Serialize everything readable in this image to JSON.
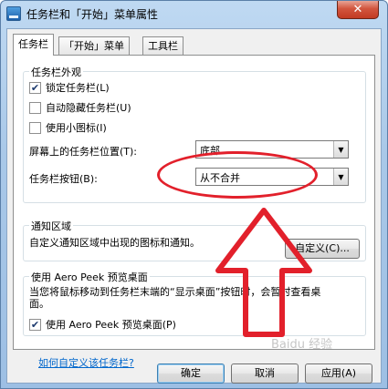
{
  "window": {
    "title": "任务栏和「开始」菜单属性",
    "close_label": "✕"
  },
  "tabs": [
    {
      "label": "任务栏",
      "active": true
    },
    {
      "label": "「开始」菜单",
      "active": false
    },
    {
      "label": "工具栏",
      "active": false
    }
  ],
  "appearance": {
    "title": "任务栏外观",
    "options": [
      {
        "label": "锁定任务栏(L)",
        "checked": true
      },
      {
        "label": "自动隐藏任务栏(U)",
        "checked": false
      },
      {
        "label": "使用小图标(I)",
        "checked": false
      }
    ],
    "position_label": "屏幕上的任务栏位置(T):",
    "position_value": "底部",
    "buttons_label": "任务栏按钮(B):",
    "buttons_value": "从不合并"
  },
  "notification": {
    "title": "通知区域",
    "description": "自定义通知区域中出现的图标和通知。",
    "customize_button": "自定义(C)..."
  },
  "aero_peek": {
    "title": "使用 Aero Peek 预览桌面",
    "description": "当您将鼠标移动到任务栏末端的“显示桌面”按钮时，会暂时查看桌面。",
    "checkbox_label": "使用 Aero Peek 预览桌面(P)",
    "checked": true
  },
  "help_link": "如何自定义该任务栏?",
  "buttons": {
    "ok": "确定",
    "cancel": "取消",
    "apply": "应用(A)"
  },
  "watermark": "Baidu 经验",
  "colors": {
    "annotation": "#e2202b",
    "link": "#0066cc"
  },
  "icons": [
    "app-icon",
    "close-icon",
    "dropdown-arrow-icon"
  ]
}
